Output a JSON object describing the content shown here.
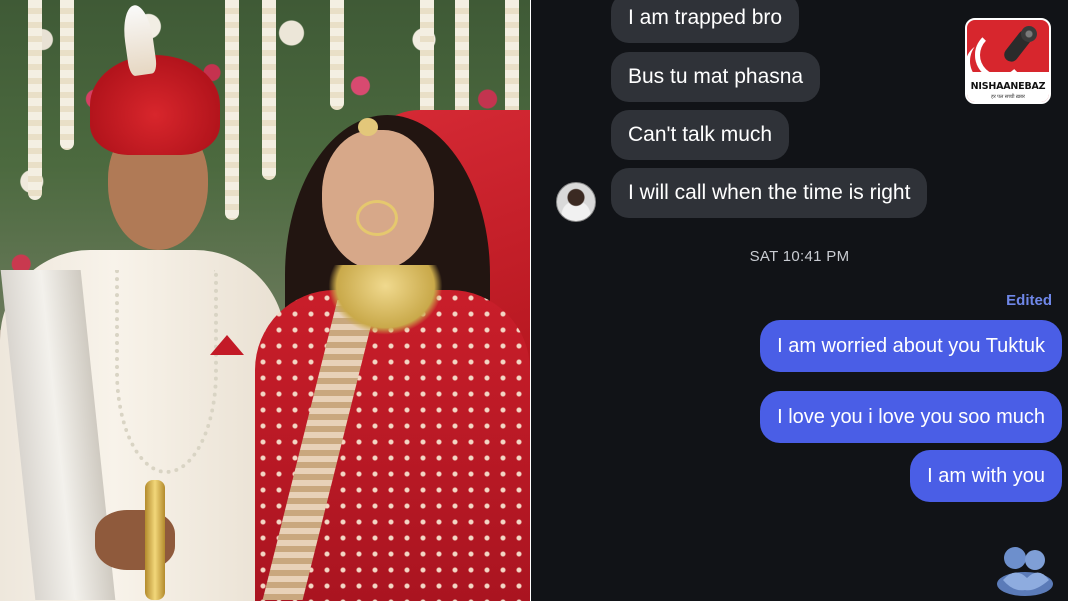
{
  "logo": {
    "name": "NISHAANEBAZ",
    "tagline": "हर पल सच्ची ख़बर",
    "brand_color": "#d7262d"
  },
  "chat": {
    "incoming": [
      {
        "text": "I am trapped bro"
      },
      {
        "text": "Bus tu mat phasna"
      },
      {
        "text": "Can't talk much"
      },
      {
        "text": "I will call when the time is right"
      }
    ],
    "timestamp": "SAT 10:41 PM",
    "edited_label": "Edited",
    "outgoing": [
      {
        "text": "I am worried about you Tuktuk"
      },
      {
        "text": "I love you i love you soo much"
      },
      {
        "text": "I am with you"
      }
    ],
    "colors": {
      "background": "#111317",
      "incoming_bubble": "#2f3238",
      "outgoing_bubble": "#4a5ee6",
      "edited_label": "#6f87e8"
    }
  },
  "icons": {
    "avatar": "profile-avatar",
    "reaction": "hug-sticker-icon"
  }
}
